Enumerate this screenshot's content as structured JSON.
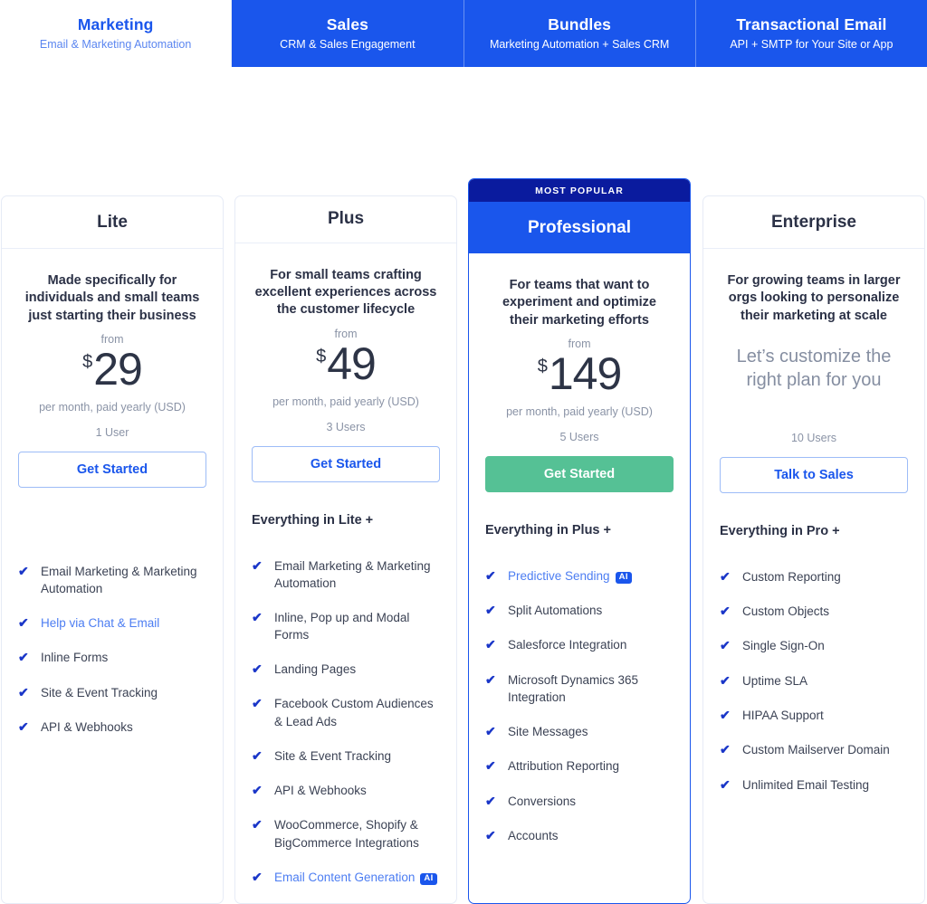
{
  "colors": {
    "brand_blue": "#1a56ec",
    "ribbon_navy": "#0a1b9e",
    "cta_green": "#55c195",
    "check_blue": "#1a36c8",
    "link_blue": "#4c7df2",
    "muted_gray": "#8a93a6",
    "text_dark": "#2b3146"
  },
  "tabs": [
    {
      "title": "Marketing",
      "subtitle": "Email & Marketing Automation",
      "active": true
    },
    {
      "title": "Sales",
      "subtitle": "CRM & Sales Engagement",
      "active": false
    },
    {
      "title": "Bundles",
      "subtitle": "Marketing Automation + Sales CRM",
      "active": false
    },
    {
      "title": "Transactional Email",
      "subtitle": "API + SMTP for Your Site or App",
      "active": false
    }
  ],
  "plans": [
    {
      "name": "Lite",
      "tagline": "Made specifically for individuals and small teams just starting their business",
      "from_label": "from",
      "currency": "$",
      "amount": "29",
      "price_note": "per month, paid yearly (USD)",
      "users": "1 User",
      "cta_label": "Get Started",
      "everything_in": "",
      "features": [
        {
          "text": "Email Marketing & Marketing Automation",
          "link": false,
          "ai": false
        },
        {
          "text": "Help via Chat & Email",
          "link": true,
          "ai": false
        },
        {
          "text": "Inline Forms",
          "link": false,
          "ai": false
        },
        {
          "text": "Site & Event Tracking",
          "link": false,
          "ai": false
        },
        {
          "text": "API & Webhooks",
          "link": false,
          "ai": false
        }
      ]
    },
    {
      "name": "Plus",
      "tagline": "For small teams crafting excellent experiences across the customer lifecycle",
      "from_label": "from",
      "currency": "$",
      "amount": "49",
      "price_note": "per month, paid yearly (USD)",
      "users": "3 Users",
      "cta_label": "Get Started",
      "everything_in": "Everything in Lite +",
      "features": [
        {
          "text": "Email Marketing & Marketing Automation",
          "link": false,
          "ai": false
        },
        {
          "text": "Inline, Pop up and Modal Forms",
          "link": false,
          "ai": false
        },
        {
          "text": "Landing Pages",
          "link": false,
          "ai": false
        },
        {
          "text": "Facebook Custom Audiences & Lead Ads",
          "link": false,
          "ai": false
        },
        {
          "text": "Site & Event Tracking",
          "link": false,
          "ai": false
        },
        {
          "text": "API & Webhooks",
          "link": false,
          "ai": false
        },
        {
          "text": "WooCommerce, Shopify & BigCommerce Integrations",
          "link": false,
          "ai": false
        },
        {
          "text": "Email Content Generation",
          "link": true,
          "ai": true
        }
      ]
    },
    {
      "name": "Professional",
      "badge": "MOST POPULAR",
      "tagline": "For teams that want to experiment and optimize their marketing efforts",
      "from_label": "from",
      "currency": "$",
      "amount": "149",
      "price_note": "per month, paid yearly (USD)",
      "users": "5 Users",
      "cta_label": "Get Started",
      "everything_in": "Everything in Plus +",
      "features": [
        {
          "text": "Predictive Sending",
          "link": true,
          "ai": true
        },
        {
          "text": "Split Automations",
          "link": false,
          "ai": false
        },
        {
          "text": "Salesforce Integration",
          "link": false,
          "ai": false
        },
        {
          "text": "Microsoft Dynamics 365 Integration",
          "link": false,
          "ai": false
        },
        {
          "text": "Site Messages",
          "link": false,
          "ai": false
        },
        {
          "text": "Attribution Reporting",
          "link": false,
          "ai": false
        },
        {
          "text": "Conversions",
          "link": false,
          "ai": false
        },
        {
          "text": "Accounts",
          "link": false,
          "ai": false
        }
      ]
    },
    {
      "name": "Enterprise",
      "tagline": "For growing teams in larger orgs looking to personalize their marketing at scale",
      "custom_price": "Let’s customize the right plan for you",
      "users": "10 Users",
      "cta_label": "Talk to Sales",
      "everything_in": "Everything in Pro +",
      "features": [
        {
          "text": "Custom Reporting",
          "link": false,
          "ai": false
        },
        {
          "text": "Custom Objects",
          "link": false,
          "ai": false
        },
        {
          "text": "Single Sign-On",
          "link": false,
          "ai": false
        },
        {
          "text": "Uptime SLA",
          "link": false,
          "ai": false
        },
        {
          "text": "HIPAA Support",
          "link": false,
          "ai": false
        },
        {
          "text": "Custom Mailserver Domain",
          "link": false,
          "ai": false
        },
        {
          "text": "Unlimited Email Testing",
          "link": false,
          "ai": false
        }
      ]
    }
  ],
  "ai_badge_label": "AI",
  "check_glyph": "✔"
}
